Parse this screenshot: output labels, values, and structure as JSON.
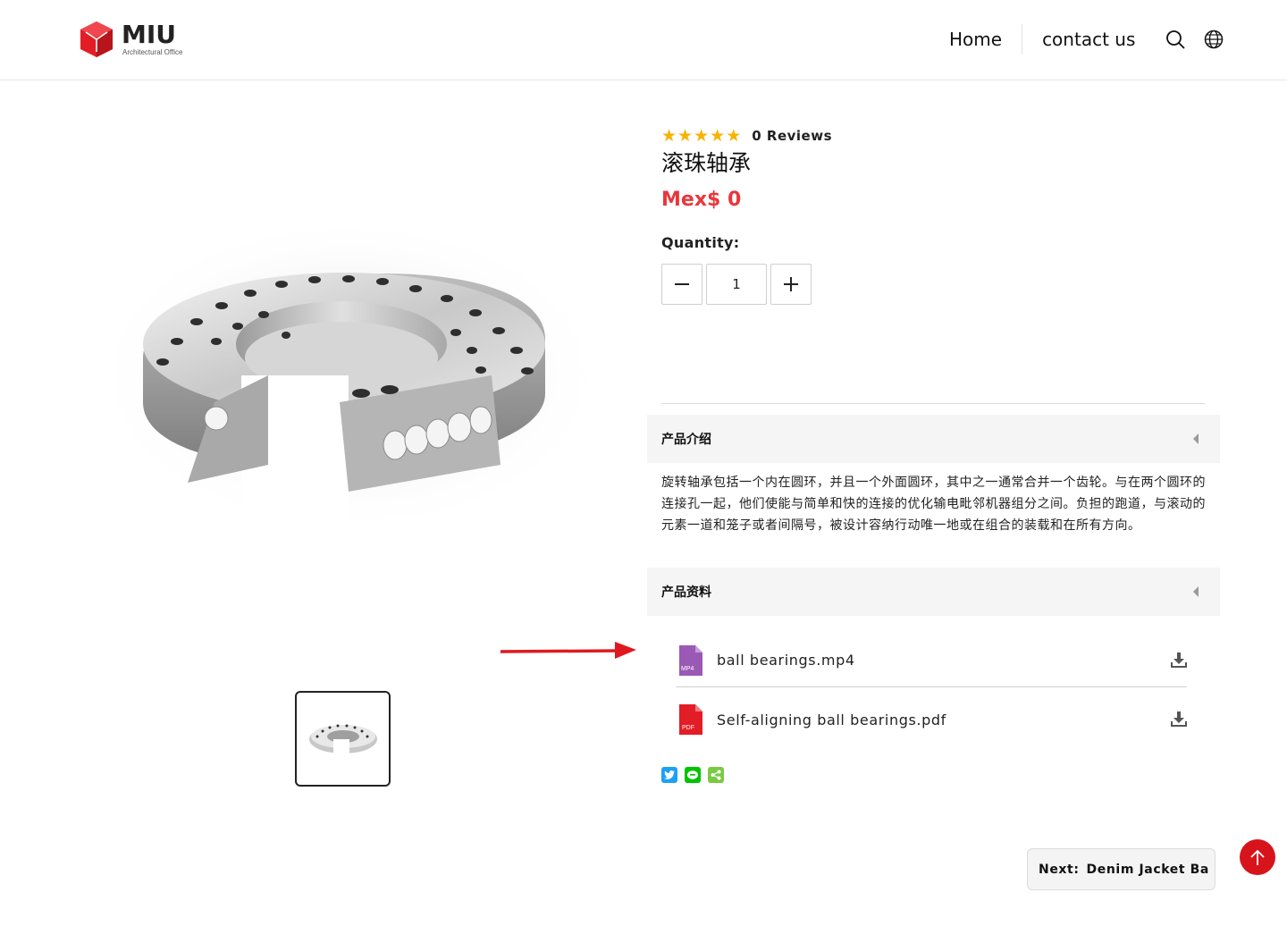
{
  "brand": {
    "name": "MIU",
    "tagline": "Architectural Office",
    "color": "#e21d26"
  },
  "nav": {
    "items": [
      {
        "label": "Home"
      },
      {
        "label": "contact us"
      }
    ],
    "icons": [
      "search-icon",
      "globe-icon"
    ]
  },
  "product": {
    "rating": 5,
    "reviews": "0 Reviews",
    "title": "滚珠轴承",
    "price": "Mex$ 0",
    "price_color": "#e8373c",
    "quantity_label": "Quantity:",
    "quantity": "1"
  },
  "sections": {
    "intro": {
      "title": "产品介绍",
      "body": "旋转轴承包括一个内在圆环，并且一个外面圆环，其中之一通常合并一个齿轮。与在两个圆环的连接孔一起，他们使能与简单和快的连接的优化输电毗邻机器组分之间。负担的跑道，与滚动的元素一道和笼子或者间隔号，被设计容纳行动唯一地或在组合的装载和在所有方向。"
    },
    "resources": {
      "title": "产品资料",
      "files": [
        {
          "name": "ball bearings.mp4",
          "type": "MP4",
          "color": "#9b59b6"
        },
        {
          "name": "Self-aligning ball bearings.pdf",
          "type": "PDF",
          "color": "#e21d26"
        }
      ]
    }
  },
  "share": [
    "twitter-icon",
    "line-icon",
    "share-icon"
  ],
  "next": {
    "label": "Next:",
    "title": "Denim Jacket Ba"
  },
  "accent": "#d7141b"
}
